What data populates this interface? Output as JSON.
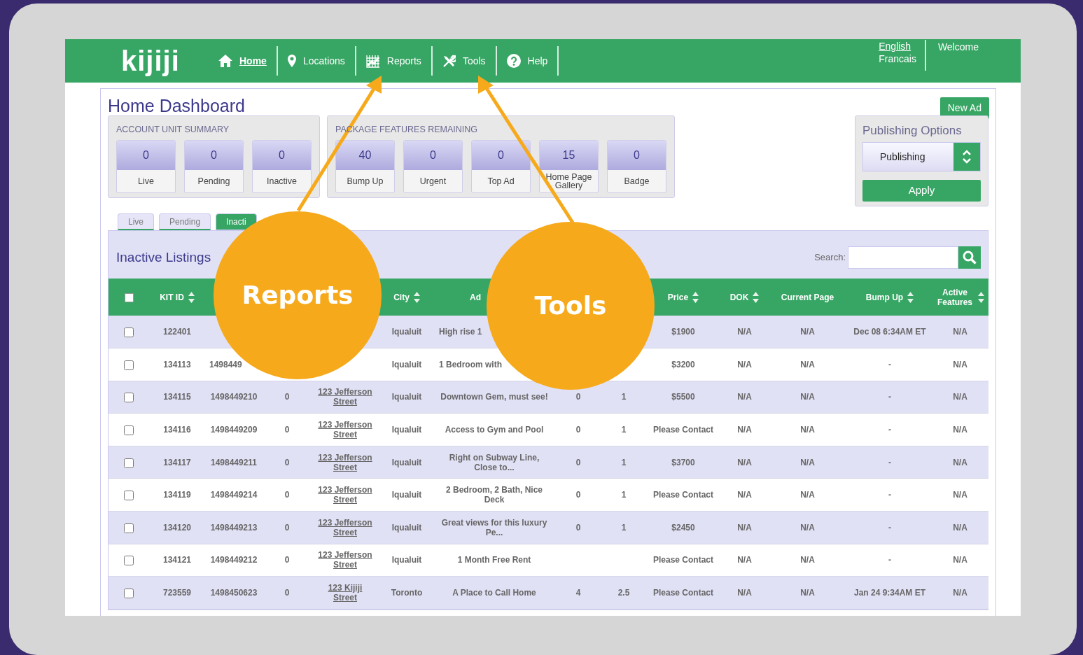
{
  "nav": {
    "logo": "kijiji",
    "items": [
      {
        "label": "Home",
        "selected": true
      },
      {
        "label": "Locations",
        "selected": false
      },
      {
        "label": "Reports",
        "selected": false
      },
      {
        "label": "Tools",
        "selected": false
      },
      {
        "label": "Help",
        "selected": false
      }
    ],
    "languages": [
      {
        "label": "English",
        "selected": true
      },
      {
        "label": "Francais",
        "selected": false
      }
    ],
    "welcome": "Welcome"
  },
  "page_title": "Home Dashboard",
  "new_ad_button": "New Ad",
  "summaries": [
    {
      "title": "ACCOUNT UNIT SUMMARY",
      "cards": [
        {
          "value": "0",
          "label": "Live"
        },
        {
          "value": "0",
          "label": "Pending"
        },
        {
          "value": "0",
          "label": "Inactive"
        }
      ]
    },
    {
      "title": "PACKAGE FEATURES REMAINING",
      "cards": [
        {
          "value": "40",
          "label": "Bump Up"
        },
        {
          "value": "0",
          "label": "Urgent"
        },
        {
          "value": "0",
          "label": "Top Ad"
        },
        {
          "value": "15",
          "label": "Home Page Gallery"
        },
        {
          "value": "0",
          "label": "Badge"
        }
      ]
    }
  ],
  "publishing": {
    "title": "Publishing Options",
    "select_value": "Publishing",
    "apply_button": "Apply"
  },
  "tabs": [
    {
      "label": "Live",
      "selected": false
    },
    {
      "label": "Pending",
      "selected": false
    },
    {
      "label": "Inacti",
      "selected": true
    }
  ],
  "listings": {
    "title": "Inactive Listings",
    "search_label": "Search:",
    "select_all_checked": false,
    "columns": [
      {
        "label": "KIT ID",
        "sortable": true
      },
      {},
      {},
      {},
      {
        "label": "City",
        "sortable": true
      },
      {
        "label": "Ad",
        "sortable": false
      },
      {},
      {},
      {
        "label": "Price",
        "sortable": true
      },
      {
        "label": "DOK",
        "sortable": true
      },
      {
        "label": "Current Page",
        "sortable": false
      },
      {
        "label": "Bump Up",
        "sortable": true
      },
      {
        "label": "Active Features",
        "sortable": true
      }
    ],
    "rows": [
      {
        "checked": false,
        "cells": [
          "122401",
          null,
          null,
          null,
          "Iqualuit",
          "High rise 1",
          null,
          null,
          "$1900",
          "N/A",
          "N/A",
          "Dec 08 6:34AM ET",
          "N/A"
        ]
      },
      {
        "checked": false,
        "cells": [
          "134113",
          "1498449",
          null,
          null,
          "Iqualuit",
          "1 Bedroom with",
          null,
          null,
          "$3200",
          "N/A",
          "N/A",
          "-",
          "N/A"
        ]
      },
      {
        "checked": false,
        "cells": [
          "134115",
          "1498449210",
          "0",
          "123 Jefferson Street",
          "Iqualuit",
          "Downtown Gem, must see!",
          "0",
          "1",
          "$5500",
          "N/A",
          "N/A",
          "-",
          "N/A"
        ]
      },
      {
        "checked": false,
        "cells": [
          "134116",
          "1498449209",
          "0",
          "123 Jefferson Street",
          "Iqualuit",
          "Access to Gym and Pool",
          "0",
          "1",
          "Please Contact",
          "N/A",
          "N/A",
          "-",
          "N/A"
        ]
      },
      {
        "checked": false,
        "cells": [
          "134117",
          "1498449211",
          "0",
          "123 Jefferson Street",
          "Iqualuit",
          "Right on Subway Line, Close to...",
          "0",
          "1",
          "$3700",
          "N/A",
          "N/A",
          "-",
          "N/A"
        ]
      },
      {
        "checked": false,
        "cells": [
          "134119",
          "1498449214",
          "0",
          "123 Jefferson Street",
          "Iqualuit",
          "2 Bedroom, 2 Bath, Nice Deck",
          "0",
          "1",
          "Please Contact",
          "N/A",
          "N/A",
          "-",
          "N/A"
        ]
      },
      {
        "checked": false,
        "cells": [
          "134120",
          "1498449213",
          "0",
          "123 Jefferson Street",
          "Iqualuit",
          "Great views for this luxury Pe...",
          "0",
          "1",
          "$2450",
          "N/A",
          "N/A",
          "-",
          "N/A"
        ]
      },
      {
        "checked": false,
        "cells": [
          "134121",
          "1498449212",
          "0",
          "123 Jefferson Street",
          "Iqualuit",
          "1 Month Free Rent",
          null,
          null,
          "Please Contact",
          "N/A",
          "N/A",
          "-",
          "N/A"
        ]
      },
      {
        "checked": false,
        "cells": [
          "723559",
          "1498450623",
          "0",
          "123 Kijiji Street",
          "Toronto",
          "A Place to Call Home",
          "4",
          "2.5",
          "Please Contact",
          "N/A",
          "N/A",
          "Jan 24 9:34AM ET",
          "N/A"
        ]
      }
    ]
  },
  "callouts": [
    {
      "label": "Reports"
    },
    {
      "label": "Tools"
    }
  ]
}
